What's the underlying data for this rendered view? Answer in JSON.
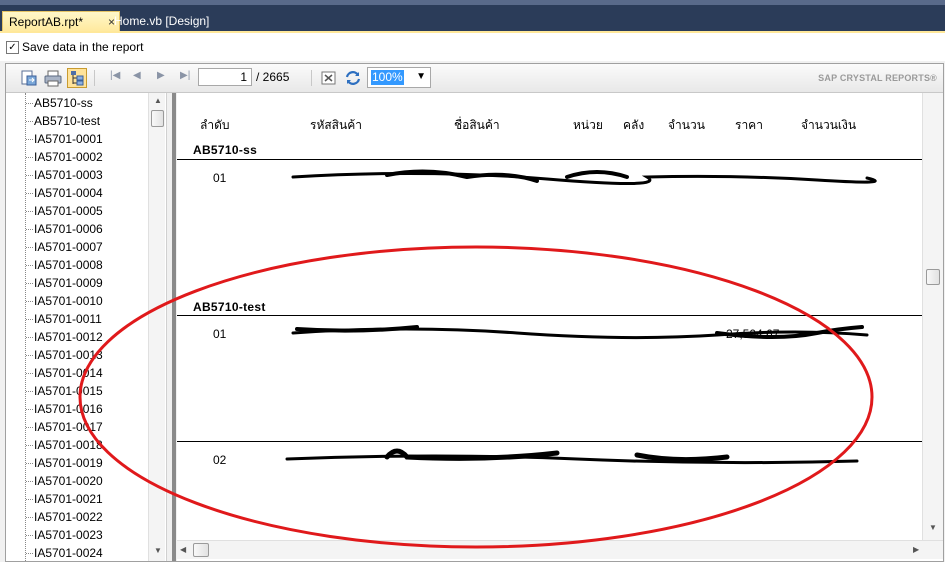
{
  "tabs": [
    {
      "label": "ReportAB.rpt*",
      "close": "×"
    },
    {
      "label": "Home.vb [Design]"
    }
  ],
  "save_option": {
    "label": "Save data in the report",
    "checked": "✓"
  },
  "toolbar": {
    "current_page": "1",
    "total_pages": "/ 2665",
    "zoom": "100%",
    "brand": "SAP CRYSTAL REPORTS®",
    "icons": [
      "export-icon",
      "print-icon",
      "toggle-group-tree-icon",
      "first-page-icon",
      "previous-page-icon",
      "next-page-icon",
      "last-page-icon",
      "stop-icon",
      "refresh-icon"
    ]
  },
  "group_tree": {
    "items": [
      "AB5710-ss",
      "AB5710-test",
      "IA5701-0001",
      "IA5701-0002",
      "IA5701-0003",
      "IA5701-0004",
      "IA5701-0005",
      "IA5701-0006",
      "IA5701-0007",
      "IA5701-0008",
      "IA5701-0009",
      "IA5701-0010",
      "IA5701-0011",
      "IA5701-0012",
      "IA5701-0013",
      "IA5701-0014",
      "IA5701-0015",
      "IA5701-0016",
      "IA5701-0017",
      "IA5701-0018",
      "IA5701-0019",
      "IA5701-0020",
      "IA5701-0021",
      "IA5701-0022",
      "IA5701-0023",
      "IA5701-0024"
    ]
  },
  "report": {
    "columns": [
      "ลำดับ",
      "รหัสสินค้า",
      "ชื่อสินค้า",
      "หน่วย",
      "คลัง",
      "จำนวน",
      "ราคา",
      "จำนวนเงิน"
    ],
    "groups": [
      {
        "name": "AB5710-ss",
        "rows": [
          {
            "seq": "01"
          }
        ]
      },
      {
        "name": "AB5710-test",
        "rows": [
          {
            "seq": "01",
            "price": "27,504.67"
          },
          {
            "seq": "02"
          }
        ]
      }
    ]
  },
  "colors": {
    "annotation": "#e0191b",
    "scribble": "#000000",
    "active_tab": "#ffe89a",
    "zoom_highlight": "#3399ff"
  }
}
